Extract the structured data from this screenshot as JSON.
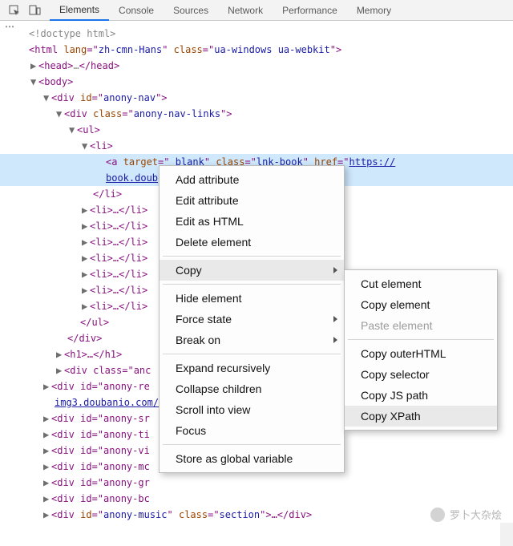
{
  "tabs": {
    "elements": "Elements",
    "console": "Console",
    "sources": "Sources",
    "network": "Network",
    "performance": "Performance",
    "memory": "Memory"
  },
  "dom": {
    "l0": "<!doctype html>",
    "l1a": "<html ",
    "l1b": "lang",
    "l1c": "=\"",
    "l1d": "zh-cmn-Hans",
    "l1e": "\" ",
    "l1f": "class",
    "l1g": "=\"",
    "l1h": "ua-windows ua-webkit",
    "l1i": "\">",
    "l2a": "<head>",
    "l2b": "…",
    "l2c": "</head>",
    "l3": "<body>",
    "l4a": "<div ",
    "l4b": "id",
    "l4c": "=\"",
    "l4d": "anony-nav",
    "l4e": "\">",
    "l5a": "<div ",
    "l5b": "class",
    "l5c": "=\"",
    "l5d": "anony-nav-links",
    "l5e": "\">",
    "l6": "<ul>",
    "l7": "<li>",
    "l8a": "<a ",
    "l8b": "target",
    "l8c": "=\"",
    "l8d": "_blank",
    "l8e": "\" ",
    "l8f": "class",
    "l8g": "=\"",
    "l8h": "lnk-book",
    "l8i": "\" ",
    "l8j": "href",
    "l8k": "=\"",
    "l8l": "https://",
    "l8m": "book.doub",
    "l9": "</li>",
    "li_collapsed": "<li>…</li>",
    "l_ul_close": "</ul>",
    "l_div_close": "</div>",
    "l_h1": "<h1>…</h1>",
    "l_anc": "<div class=\"anc",
    "l_anony_re1": "<div id=\"anony-re",
    "l_anony_re2": "img3.doubanio.com/",
    "l_anony_sr": "<div id=\"anony-sr",
    "l_anony_ti": "<div id=\"anony-ti",
    "l_anony_vi": "<div id=\"anony-vi",
    "l_anony_mc": "<div id=\"anony-mc",
    "l_anony_gr": "<div id=\"anony-gr",
    "l_anony_bc": "<div id=\"anony-bc",
    "l_anony_music_a": "<div ",
    "l_amusic_id": "id",
    "l_amusic_idv": "anony-music",
    "l_amusic_cls": "class",
    "l_amusic_clsv": "section",
    "l_amusic_end": ">…</div>",
    "ellipsis": "…",
    "re_end": ">"
  },
  "menu1": {
    "add_attr": "Add attribute",
    "edit_attr": "Edit attribute",
    "edit_html": "Edit as HTML",
    "delete": "Delete element",
    "copy": "Copy",
    "hide": "Hide element",
    "force": "Force state",
    "break": "Break on",
    "expand": "Expand recursively",
    "collapse": "Collapse children",
    "scroll": "Scroll into view",
    "focus": "Focus",
    "store": "Store as global variable"
  },
  "menu2": {
    "cut": "Cut element",
    "copy_el": "Copy element",
    "paste": "Paste element",
    "outer": "Copy outerHTML",
    "selector": "Copy selector",
    "jspath": "Copy JS path",
    "xpath": "Copy XPath"
  },
  "watermark": "罗卜大杂烩"
}
